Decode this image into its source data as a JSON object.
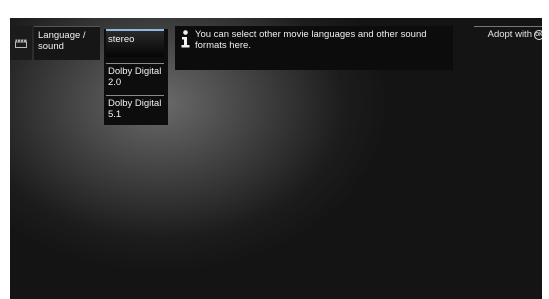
{
  "menu": {
    "category_icon": "clapperboard-icon",
    "category_label": "Language / sound"
  },
  "options": [
    {
      "label": "stereo",
      "selected": true
    },
    {
      "label": "Dolby Digital 2.0",
      "selected": false
    },
    {
      "label": "Dolby Digital 5.1",
      "selected": false
    }
  ],
  "info": {
    "icon": "info-icon",
    "text": "You can select other movie languages and other sound formats here."
  },
  "action": {
    "label": "Adopt with",
    "icon": "ok-button-icon",
    "icon_text": "OK"
  },
  "colors": {
    "selection_accent": "#8fb8e0",
    "panel": "#0c0c0c"
  }
}
